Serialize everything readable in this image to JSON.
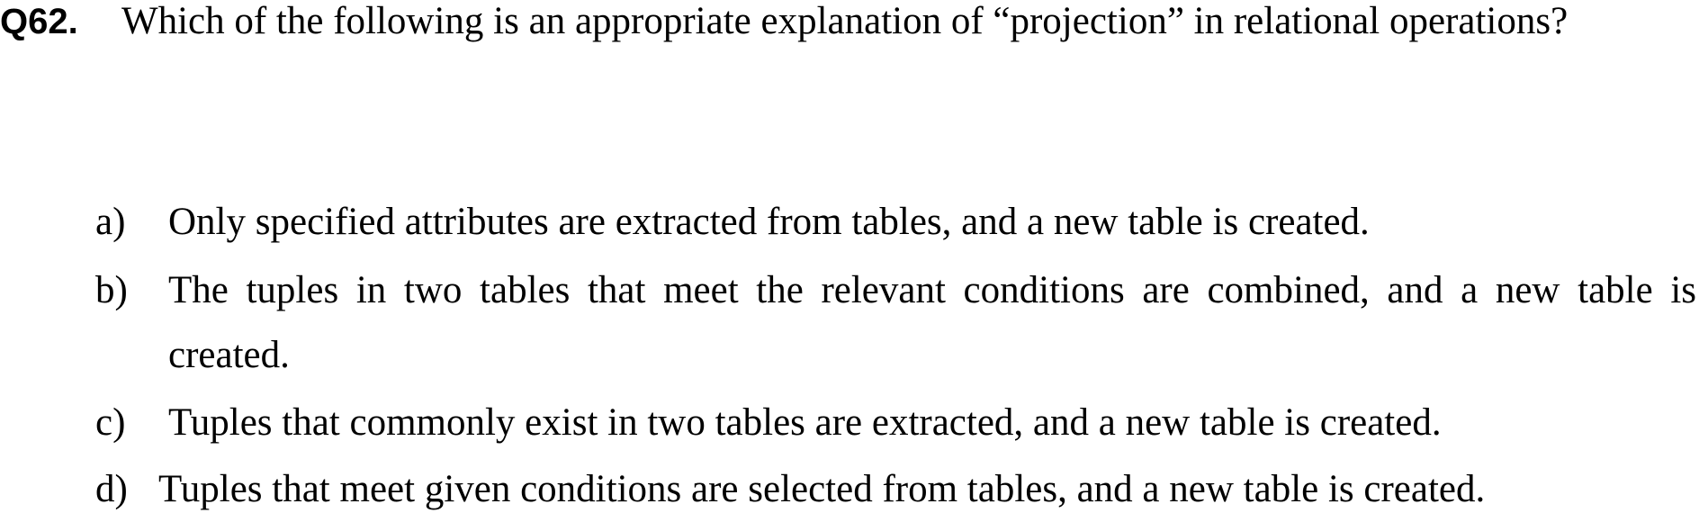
{
  "question": {
    "number": "Q62.",
    "text": "Which of the following is an appropriate explanation of “projection” in relational operations?"
  },
  "options": [
    {
      "label": "a)",
      "text": "Only specified attributes are extracted from tables, and a new table is created."
    },
    {
      "label": "b)",
      "text": "The tuples in two tables that meet the relevant conditions are combined, and a new table is created."
    },
    {
      "label": "c)",
      "text": "Tuples that commonly exist in two tables are extracted, and a new table is created."
    },
    {
      "label": "d)",
      "text": "Tuples that meet given conditions are selected from tables, and a new table is created."
    }
  ]
}
